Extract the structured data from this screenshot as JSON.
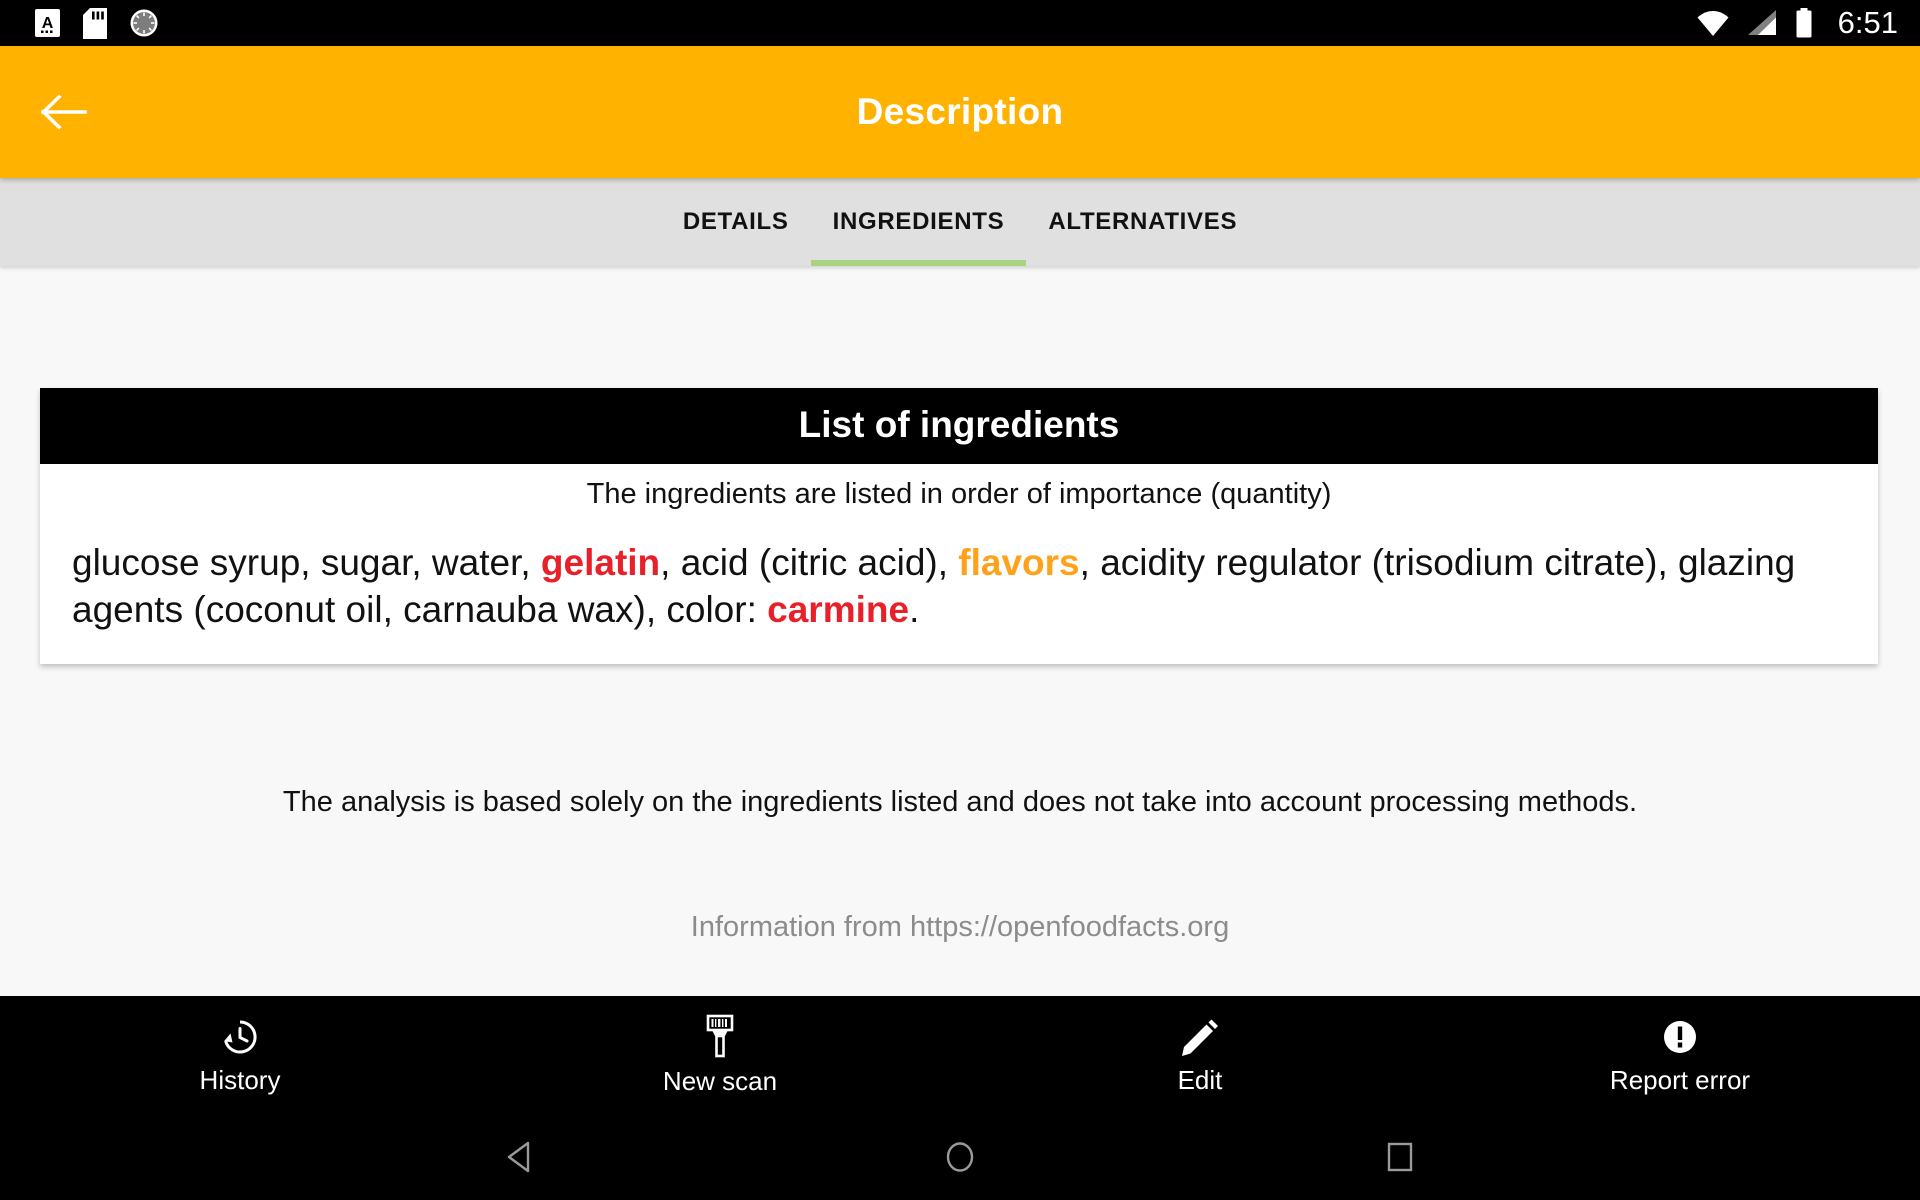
{
  "status_bar": {
    "icons": [
      "notification-a-icon",
      "sd-card-icon",
      "sync-circle-icon",
      "wifi-icon",
      "cellular-signal-icon",
      "battery-icon"
    ],
    "time": "6:51"
  },
  "app_bar": {
    "back_icon": "arrow-back-icon",
    "title": "Description",
    "background_color": "#ffb300",
    "title_color": "#ffffff"
  },
  "tabs": {
    "items": [
      {
        "label": "DETAILS",
        "active": false
      },
      {
        "label": "INGREDIENTS",
        "active": true
      },
      {
        "label": "ALTERNATIVES",
        "active": false
      }
    ],
    "indicator_color": "#a9d47f",
    "background_color": "#e0e0e0"
  },
  "ingredients_card": {
    "header": "List of ingredients",
    "subtitle": "The ingredients are listed in order of importance (quantity)",
    "segments": [
      {
        "text": "glucose syrup, sugar, water, ",
        "style": "normal"
      },
      {
        "text": "gelatin",
        "style": "red"
      },
      {
        "text": ", acid (citric acid), ",
        "style": "normal"
      },
      {
        "text": "flavors",
        "style": "orange"
      },
      {
        "text": ", acidity regulator (trisodium citrate), glazing agents (coconut oil, carnauba wax), color: ",
        "style": "normal"
      },
      {
        "text": "carmine",
        "style": "red"
      },
      {
        "text": ".",
        "style": "normal"
      }
    ],
    "full_text": "glucose syrup, sugar, water, gelatin, acid (citric acid), flavors, acidity regulator (trisodium citrate), glazing agents (coconut oil, carnauba wax), color: carmine.",
    "highlight_red": "#e8202a",
    "highlight_orange": "#ffa21a"
  },
  "analysis_note": "The analysis is based solely on the ingredients listed and does not take into account processing methods.",
  "source_note": "Information from https://openfoodfacts.org",
  "bottom_nav": {
    "items": [
      {
        "label": "History",
        "icon": "history-clock-icon"
      },
      {
        "label": "New scan",
        "icon": "barcode-scanner-icon"
      },
      {
        "label": "Edit",
        "icon": "pencil-edit-icon"
      },
      {
        "label": "Report error",
        "icon": "error-exclamation-icon"
      }
    ]
  },
  "system_nav": {
    "back": "triangle-back-icon",
    "home": "circle-home-icon",
    "recents": "square-recents-icon"
  }
}
